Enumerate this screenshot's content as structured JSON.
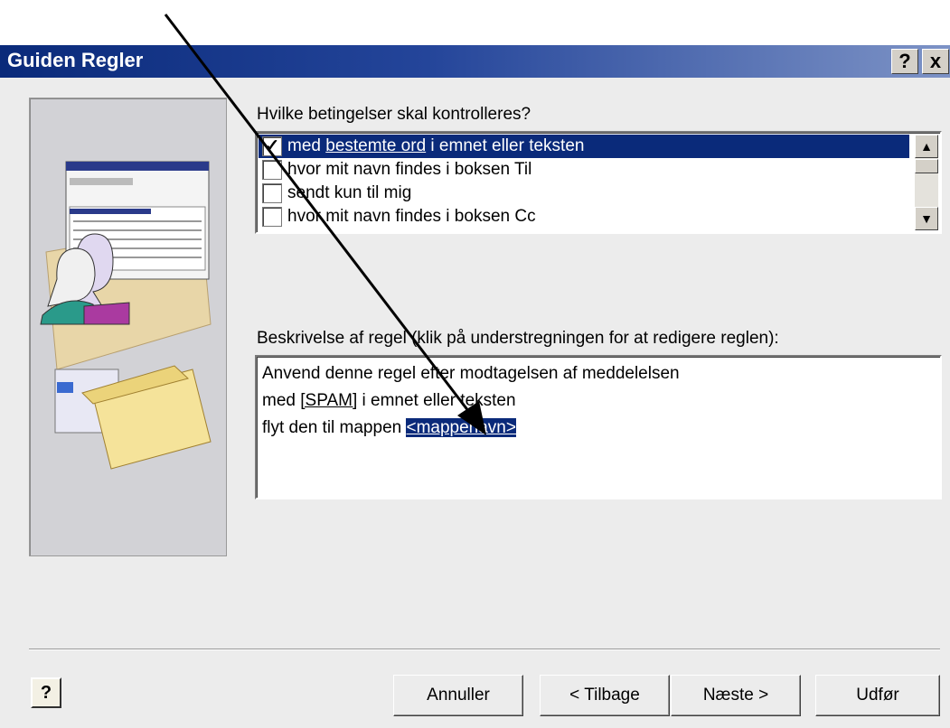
{
  "dialog": {
    "title": "Guiden Regler",
    "help_button": "?",
    "close_button": "x"
  },
  "conditions": {
    "label": "Hvilke betingelser skal kontrolleres?",
    "items": [
      {
        "checked": true,
        "prefix": "med ",
        "link": "bestemte ord",
        "suffix": " i emnet eller teksten"
      },
      {
        "checked": false,
        "prefix": "hvor mit navn findes i boksen Til",
        "link": "",
        "suffix": ""
      },
      {
        "checked": false,
        "prefix": "sendt kun til mig",
        "link": "",
        "suffix": ""
      },
      {
        "checked": false,
        "prefix": "hvor mit navn findes i boksen Cc",
        "link": "",
        "suffix": ""
      }
    ]
  },
  "description": {
    "label": "Beskrivelse af regel (klik på understregningen for at redigere reglen):",
    "line1": "Anvend denne regel efter modtagelsen af meddelelsen",
    "line2_prefix": "med ",
    "line2_link": "[SPAM]",
    "line2_suffix": " i emnet eller teksten",
    "line3_prefix": "flyt den til mappen ",
    "line3_link": "<mappenavn>"
  },
  "buttons": {
    "help": "?",
    "cancel": "Annuller",
    "back": "< Tilbage",
    "next": "Næste >",
    "finish": "Udfør"
  },
  "icons": [
    "checkmark-icon",
    "scroll-up-icon",
    "scroll-down-icon",
    "help-icon",
    "arrow-annotation",
    "wizard-illustration"
  ],
  "colors": {
    "titlebar": "#0a2a7a",
    "selection": "#0a2a7a",
    "dialog_bg": "#ececec"
  }
}
